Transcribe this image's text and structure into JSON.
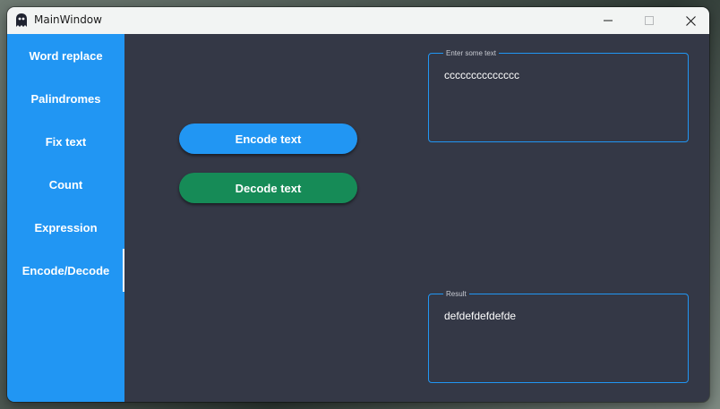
{
  "window": {
    "title": "MainWindow",
    "icon": "ghost-icon",
    "controls": [
      "minimize-icon",
      "maximize-icon",
      "close-icon"
    ]
  },
  "sidebar": {
    "items": [
      {
        "label": "Word replace",
        "active": false
      },
      {
        "label": "Palindromes",
        "active": false
      },
      {
        "label": "Fix text",
        "active": false
      },
      {
        "label": "Count",
        "active": false
      },
      {
        "label": "Expression",
        "active": false
      },
      {
        "label": "Encode/Decode",
        "active": true
      }
    ]
  },
  "actions": {
    "encode_label": "Encode text",
    "decode_label": "Decode text"
  },
  "input": {
    "legend": "Enter some text",
    "value": "cccccccccccccc"
  },
  "output": {
    "legend": "Result",
    "value": "defdefdefdefde"
  },
  "colors": {
    "accent": "#2196f3",
    "decode": "#168b57",
    "background": "#343846",
    "titlebar": "#f2f4f3"
  }
}
